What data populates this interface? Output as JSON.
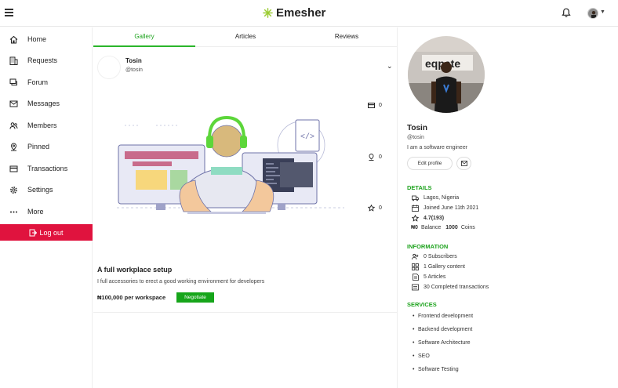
{
  "brand": {
    "name": "Emesher",
    "accent": "#9ccc34"
  },
  "sidebar": {
    "items": [
      {
        "label": "Home",
        "icon": "home-icon"
      },
      {
        "label": "Requests",
        "icon": "building-icon"
      },
      {
        "label": "Forum",
        "icon": "forum-icon"
      },
      {
        "label": "Messages",
        "icon": "mail-icon"
      },
      {
        "label": "Members",
        "icon": "members-icon"
      },
      {
        "label": "Pinned",
        "icon": "pin-icon"
      },
      {
        "label": "Transactions",
        "icon": "card-icon"
      },
      {
        "label": "Settings",
        "icon": "gear-icon"
      },
      {
        "label": "More",
        "icon": "dots-icon"
      }
    ],
    "logout_label": "Log out",
    "logout_color": "#e0133e"
  },
  "tabs": {
    "items": [
      "Gallery",
      "Articles",
      "Reviews"
    ],
    "active": "Gallery",
    "active_color": "#1ea31e"
  },
  "card": {
    "user_name": "Tosin",
    "user_handle": "@tosin",
    "stats": {
      "cards": "0",
      "pins": "0",
      "stars": "0"
    },
    "title": "A full workplace setup",
    "description": "I full accessories to erect a good working environment for developers",
    "price": "₦100,000 per workspace",
    "negotiate_label": "Negotiate"
  },
  "profile": {
    "name": "Tosin",
    "handle": "@tosin",
    "bio": "I am a software engineer",
    "edit_label": "Edit profile",
    "details_title": "DETAILS",
    "location": "Lagos, Nigeria",
    "joined": "Joined June 11th 2021",
    "rating": "4.7(193)",
    "balance_prefix": "₦0",
    "balance_label": "Balance",
    "coins_value": "1000",
    "coins_label": "Coins",
    "information_title": "INFORMATION",
    "subscribers": "0 Subscribers",
    "gallery_content": "1 Gallery content",
    "articles": "5 Articles",
    "transactions": "30 Completed transactions",
    "services_title": "SERVICES",
    "services": [
      "Frontend development",
      "Backend development",
      "Software Architecture",
      "SEO",
      "Software Testing"
    ]
  }
}
